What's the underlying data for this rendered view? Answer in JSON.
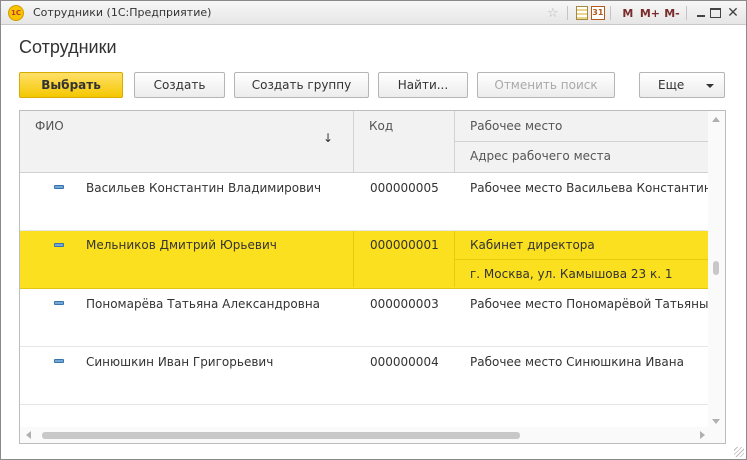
{
  "window": {
    "title": "Сотрудники  (1С:Предприятие)",
    "logo_text": "1С",
    "titlebar_icons": {
      "star": "☆",
      "calendar_day": "31",
      "m": "M",
      "m_plus": "M+",
      "m_minus": "M-",
      "close": "✕"
    }
  },
  "page": {
    "title": "Сотрудники"
  },
  "toolbar": {
    "select_label": "Выбрать",
    "create_label": "Создать",
    "create_group_label": "Создать группу",
    "find_label": "Найти...",
    "cancel_search_label": "Отменить поиск",
    "more_label": "Еще"
  },
  "table": {
    "headers": {
      "name": "ФИО",
      "code": "Код",
      "workplace": "Рабочее место",
      "workplace_address": "Адрес рабочего места",
      "sort_arrow": "↓"
    },
    "rows": [
      {
        "name": "Васильев Константин Владимирович",
        "code": "000000005",
        "workplace": "Рабочее место Васильева Константина",
        "address": "",
        "selected": false
      },
      {
        "name": "Мельников Дмитрий Юрьевич",
        "code": "000000001",
        "workplace": "Кабинет директора",
        "address": "г. Москва, ул. Камышова 23 к. 1",
        "selected": true
      },
      {
        "name": "Пономарёва Татьяна Александровна",
        "code": "000000003",
        "workplace": "Рабочее место Пономарёвой Татьяны",
        "address": "",
        "selected": false
      },
      {
        "name": "Синюшкин Иван Григорьевич",
        "code": "000000004",
        "workplace": "Рабочее место Синюшкина Ивана",
        "address": "",
        "selected": false
      }
    ]
  },
  "colors": {
    "accent_yellow": "#f4c800",
    "selected_row": "#fbe01f",
    "item_icon": "#6fa7d8"
  }
}
